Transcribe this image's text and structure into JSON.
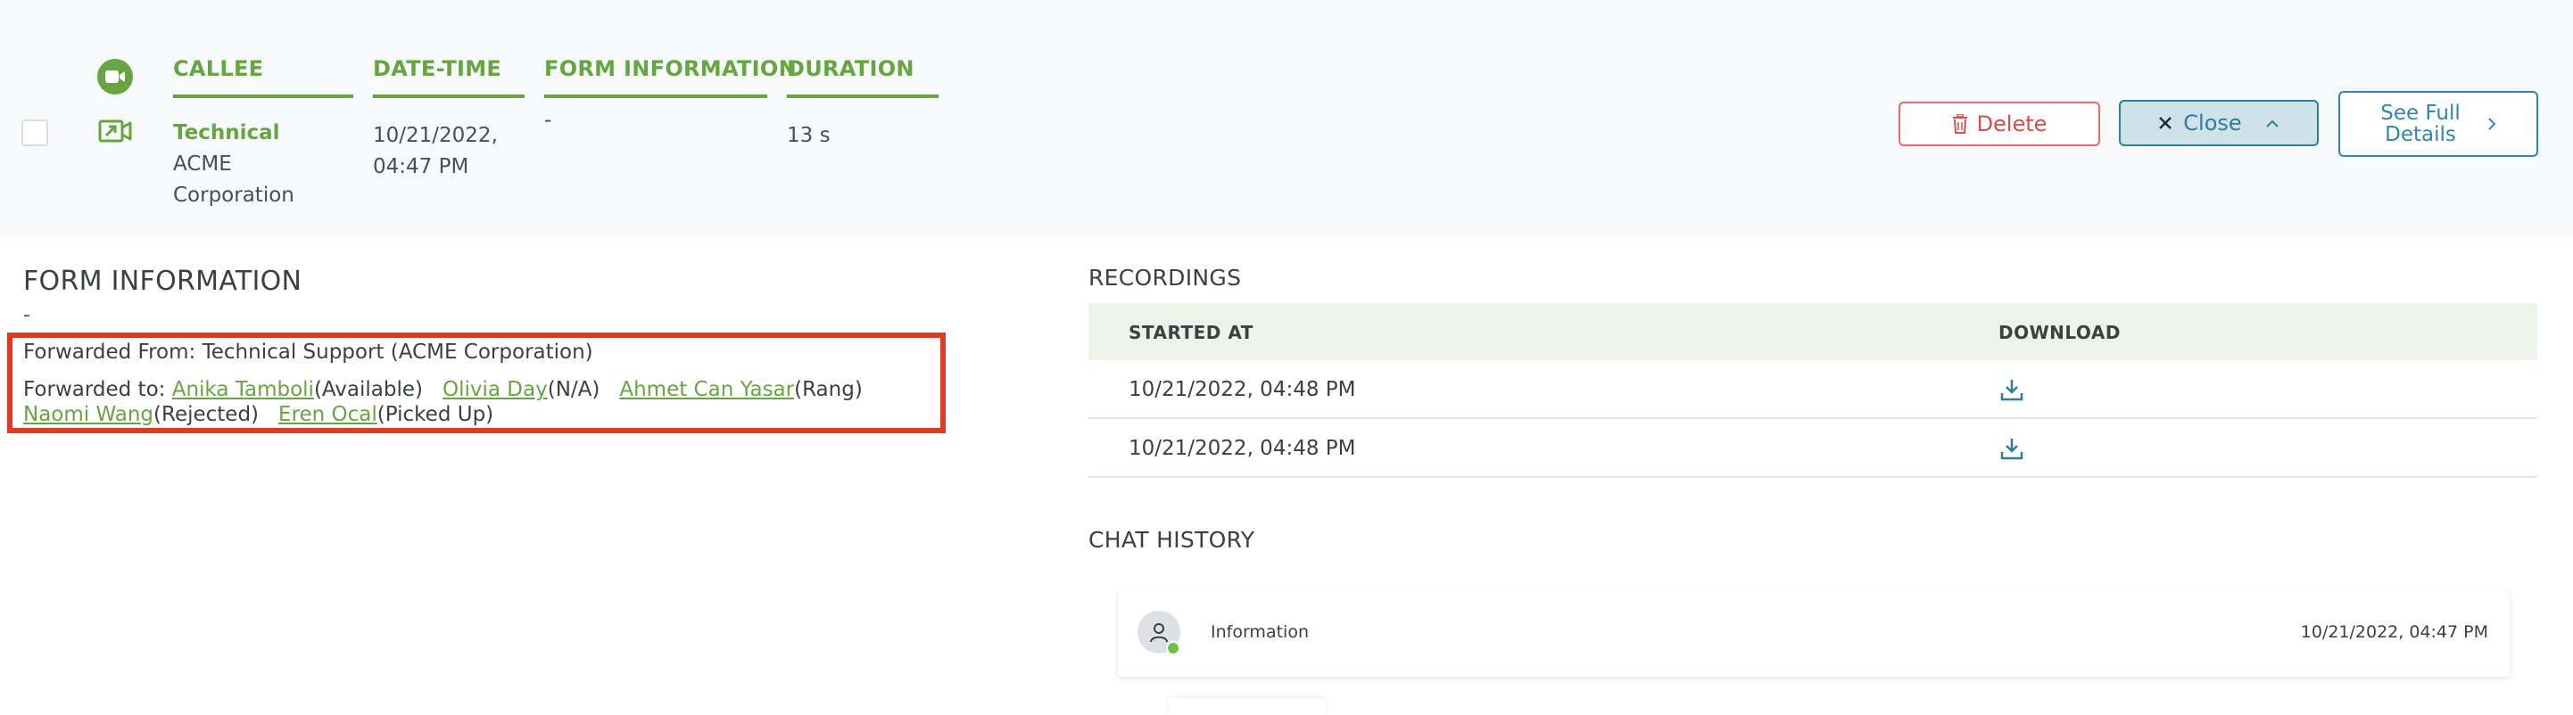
{
  "call": {
    "columns": {
      "callee": "CALLEE",
      "datetime": "DATE-TIME",
      "form_information": "FORM INFORMATION",
      "duration": "DURATION"
    },
    "callee_name": "Technical",
    "callee_company_line1": "ACME",
    "callee_company_line2": "Corporation",
    "date_line1": "10/21/2022,",
    "date_line2": "04:47 PM",
    "form_value": "-",
    "duration_value": "13 s",
    "delete_label": "Delete",
    "close_label": "Close",
    "see_full_line1": "See Full",
    "see_full_line2": "Details",
    "icons": [
      "video-icon",
      "outgoing-call-icon",
      "trash-icon",
      "close-x-icon",
      "chevron-up-icon",
      "chevron-right-icon"
    ]
  },
  "form_info": {
    "title": "FORM INFORMATION",
    "value": "-",
    "forwarded_from": "Forwarded From: Technical Support (ACME Corporation)",
    "forwarded_to_label": "Forwarded to: ",
    "forwarded_to": [
      {
        "name": "Anika Tamboli",
        "status": "(Available)"
      },
      {
        "name": "Olivia Day",
        "status": "(N/A)"
      },
      {
        "name": "Ahmet Can Yasar",
        "status": "(Rang)"
      },
      {
        "name": "Naomi Wang",
        "status": "(Rejected)"
      },
      {
        "name": "Eren Ocal",
        "status": "(Picked Up)"
      }
    ]
  },
  "recordings": {
    "title": "RECORDINGS",
    "header_started": "STARTED AT",
    "header_download": "DOWNLOAD",
    "rows": [
      {
        "started_at": "10/21/2022, 04:48 PM"
      },
      {
        "started_at": "10/21/2022, 04:48 PM"
      }
    ]
  },
  "chat": {
    "title": "CHAT HISTORY",
    "label": "Information",
    "time": "10/21/2022, 04:47 PM"
  },
  "colors": {
    "accent_green": "#66a640",
    "delete_red": "#d94c4c",
    "close_blue": "#2f7d9a",
    "highlight_border": "#e03a22",
    "online_dot": "#6cc24a"
  }
}
